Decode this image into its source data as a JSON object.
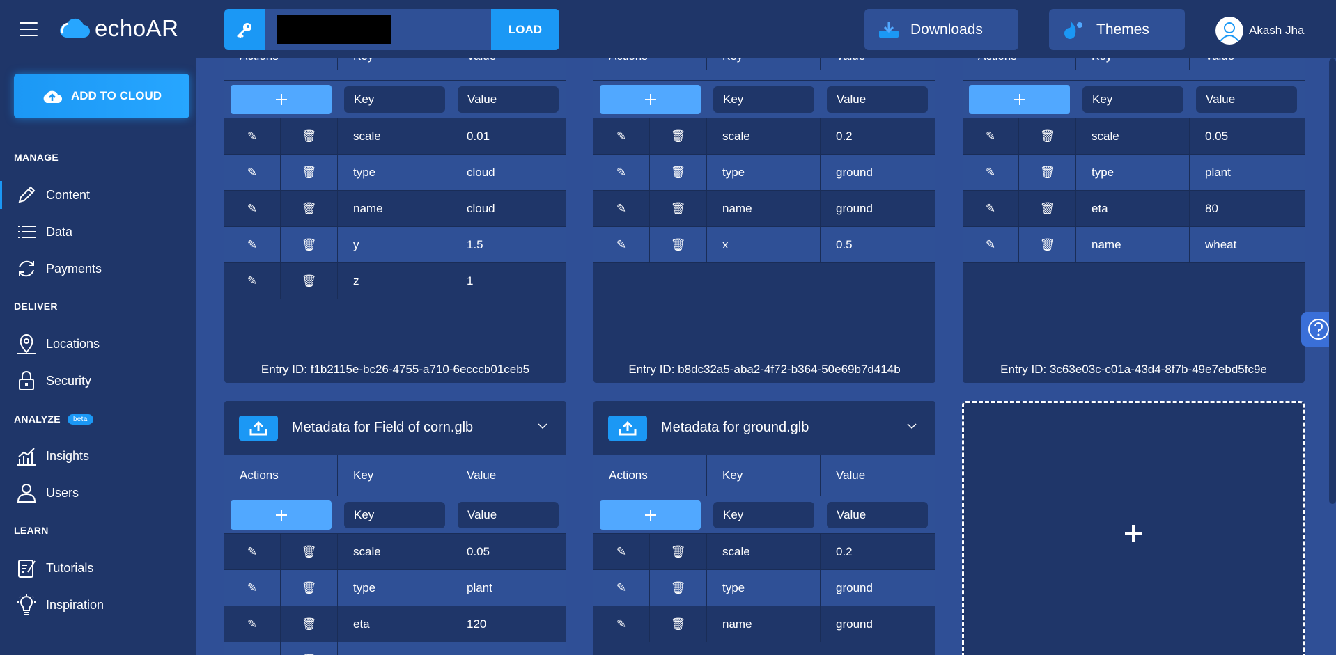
{
  "app": {
    "logo": "echoAR"
  },
  "topbar": {
    "load_label": "LOAD",
    "downloads_label": "Downloads",
    "themes_label": "Themes",
    "user_name": "Akash Jha"
  },
  "sidebar": {
    "add_to_cloud": "ADD TO CLOUD",
    "sections": {
      "manage": "MANAGE",
      "deliver": "DELIVER",
      "analyze": "ANALYZE",
      "beta": "beta",
      "learn": "LEARN"
    },
    "items": [
      {
        "label": "Content",
        "icon": "pencil-icon"
      },
      {
        "label": "Data",
        "icon": "list-icon"
      },
      {
        "label": "Payments",
        "icon": "refresh-icon"
      },
      {
        "label": "Locations",
        "icon": "map-pin-icon"
      },
      {
        "label": "Security",
        "icon": "lock-icon"
      },
      {
        "label": "Insights",
        "icon": "chart-icon"
      },
      {
        "label": "Users",
        "icon": "user-icon"
      },
      {
        "label": "Tutorials",
        "icon": "tutorial-icon"
      },
      {
        "label": "Inspiration",
        "icon": "lightbulb-icon"
      }
    ]
  },
  "table": {
    "col_actions": "Actions",
    "col_key": "Key",
    "col_value": "Value",
    "key_placeholder": "Key",
    "value_placeholder": "Value"
  },
  "cards": [
    {
      "entry_id": "Entry ID: f1b2115e-bc26-4755-a710-6ecccb01ceb5",
      "rows": [
        {
          "key": "scale",
          "value": "0.01"
        },
        {
          "key": "type",
          "value": "cloud"
        },
        {
          "key": "name",
          "value": "cloud"
        },
        {
          "key": "y",
          "value": "1.5"
        },
        {
          "key": "z",
          "value": "1"
        }
      ]
    },
    {
      "entry_id": "Entry ID: b8dc32a5-aba2-4f72-b364-50e69b7d414b",
      "rows": [
        {
          "key": "scale",
          "value": "0.2"
        },
        {
          "key": "type",
          "value": "ground"
        },
        {
          "key": "name",
          "value": "ground"
        },
        {
          "key": "x",
          "value": "0.5"
        }
      ]
    },
    {
      "entry_id": "Entry ID: 3c63e03c-c01a-43d4-8f7b-49e7ebd5fc9e",
      "rows": [
        {
          "key": "scale",
          "value": "0.05"
        },
        {
          "key": "type",
          "value": "plant"
        },
        {
          "key": "eta",
          "value": "80"
        },
        {
          "key": "name",
          "value": "wheat"
        }
      ]
    },
    {
      "title": "Metadata for Field of corn.glb",
      "rows": [
        {
          "key": "scale",
          "value": "0.05"
        },
        {
          "key": "type",
          "value": "plant"
        },
        {
          "key": "eta",
          "value": "120"
        }
      ]
    },
    {
      "title": "Metadata for ground.glb",
      "rows": [
        {
          "key": "scale",
          "value": "0.2"
        },
        {
          "key": "type",
          "value": "ground"
        },
        {
          "key": "name",
          "value": "ground"
        }
      ]
    }
  ],
  "colors": {
    "accent": "#1b98f5",
    "panel": "#1f3669",
    "row_alt": "#2f5096",
    "background": "#2f4f96"
  }
}
